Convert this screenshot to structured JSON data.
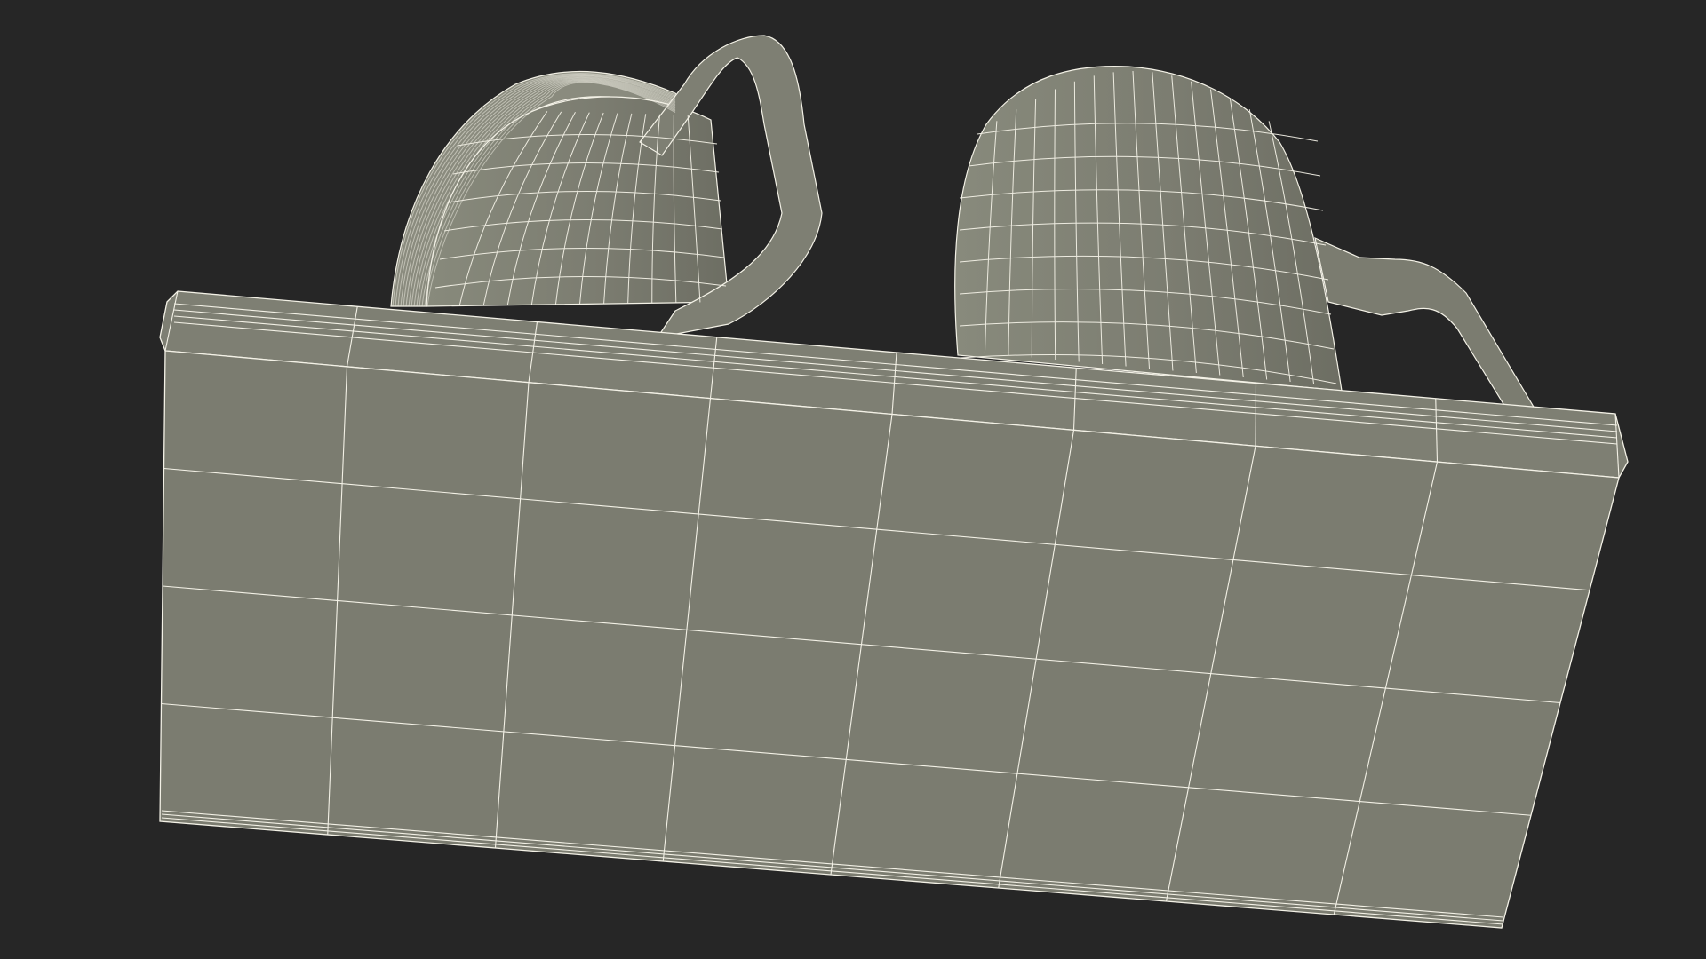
{
  "scene": {
    "background_color": "#262626",
    "surface_color": "#7b7c70",
    "surface_shadow_color": "#6f7064",
    "wire_color": "#f3f1e6",
    "objects": [
      {
        "kind": "tray",
        "name": "rectangular-tray"
      },
      {
        "kind": "mug",
        "name": "left-mug",
        "detail": "dense-rim"
      },
      {
        "kind": "mug",
        "name": "right-mug",
        "detail": "tall-straight-handle"
      }
    ]
  }
}
